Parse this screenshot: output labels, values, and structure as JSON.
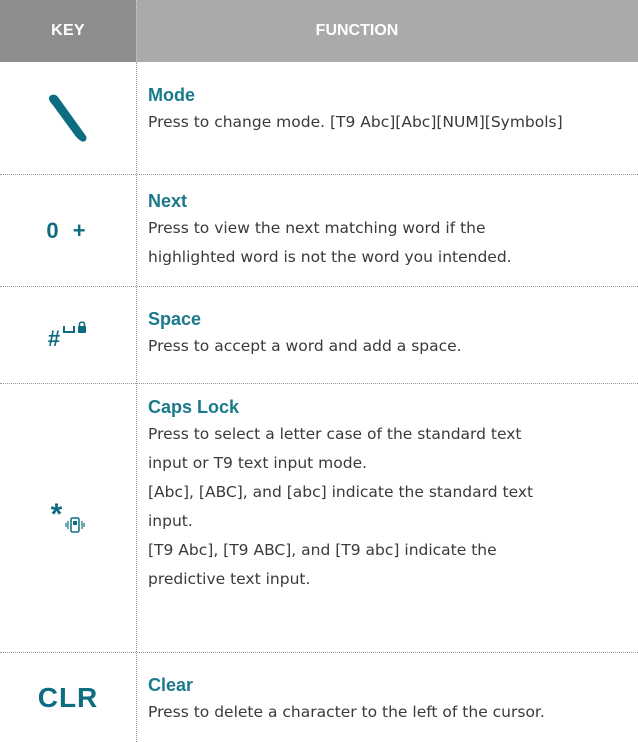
{
  "header": {
    "key_label": "KEY",
    "function_label": "FUNCTION"
  },
  "rows": [
    {
      "key_icon": "send-call-icon",
      "title": "Mode",
      "lines": [
        "Press to change mode. [T9 Abc][Abc][NUM][Symbols]"
      ]
    },
    {
      "key_text": "0 +",
      "title": "Next",
      "lines": [
        "Press to view the next matching word if the",
        "highlighted word is not the word you intended."
      ]
    },
    {
      "key_text": "#",
      "key_icon": "space-lock-icon",
      "title": "Space",
      "lines": [
        "Press to accept a word and add a space."
      ]
    },
    {
      "key_text": "*",
      "key_icon": "vibrate-icon",
      "title": "Caps Lock",
      "lines": [
        "Press to select a letter case of the standard text",
        "input or T9 text input mode.",
        "[Abc], [ABC], and [abc] indicate the standard text",
        "input.",
        "[T9 Abc], [T9 ABC], and [T9 abc] indicate the",
        "predictive text input."
      ]
    },
    {
      "key_text": "CLR",
      "title": "Clear",
      "lines": [
        "Press to delete a character to the left of the cursor."
      ]
    }
  ],
  "colors": {
    "accent": "#1a7a8c",
    "header_key_bg": "#8d8d8d",
    "header_func_bg": "#aaaaaa"
  }
}
